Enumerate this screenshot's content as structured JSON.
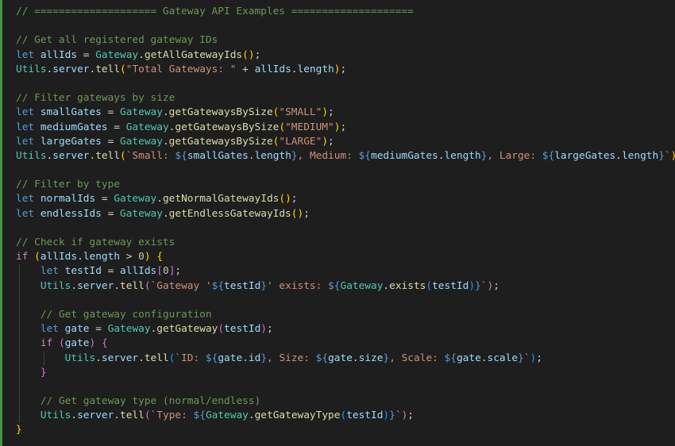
{
  "editor": {
    "lines": [
      [
        [
          "// ==================== Gateway API Examples ====================",
          "comment"
        ]
      ],
      [],
      [
        [
          "// Get all registered gateway IDs",
          "comment"
        ]
      ],
      [
        [
          "let",
          "keyword"
        ],
        [
          " ",
          "punct"
        ],
        [
          "allIds",
          "variable"
        ],
        [
          " = ",
          "punct"
        ],
        [
          "Gateway",
          "class"
        ],
        [
          ".",
          "punct"
        ],
        [
          "getAllGatewayIds",
          "function"
        ],
        [
          "()",
          "bracket1"
        ],
        [
          ";",
          "punct"
        ]
      ],
      [
        [
          "Utils",
          "class"
        ],
        [
          ".",
          "punct"
        ],
        [
          "server",
          "variable"
        ],
        [
          ".",
          "punct"
        ],
        [
          "tell",
          "function"
        ],
        [
          "(",
          "bracket1"
        ],
        [
          "\"Total Gateways: \"",
          "string"
        ],
        [
          " + ",
          "punct"
        ],
        [
          "allIds",
          "variable"
        ],
        [
          ".",
          "punct"
        ],
        [
          "length",
          "variable"
        ],
        [
          ")",
          "bracket1"
        ],
        [
          ";",
          "punct"
        ]
      ],
      [],
      [
        [
          "// Filter gateways by size",
          "comment"
        ]
      ],
      [
        [
          "let",
          "keyword"
        ],
        [
          " ",
          "punct"
        ],
        [
          "smallGates",
          "variable"
        ],
        [
          " = ",
          "punct"
        ],
        [
          "Gateway",
          "class"
        ],
        [
          ".",
          "punct"
        ],
        [
          "getGatewaysBySize",
          "function"
        ],
        [
          "(",
          "bracket1"
        ],
        [
          "\"SMALL\"",
          "string"
        ],
        [
          ")",
          "bracket1"
        ],
        [
          ";",
          "punct"
        ]
      ],
      [
        [
          "let",
          "keyword"
        ],
        [
          " ",
          "punct"
        ],
        [
          "mediumGates",
          "variable"
        ],
        [
          " = ",
          "punct"
        ],
        [
          "Gateway",
          "class"
        ],
        [
          ".",
          "punct"
        ],
        [
          "getGatewaysBySize",
          "function"
        ],
        [
          "(",
          "bracket1"
        ],
        [
          "\"MEDIUM\"",
          "string"
        ],
        [
          ")",
          "bracket1"
        ],
        [
          ";",
          "punct"
        ]
      ],
      [
        [
          "let",
          "keyword"
        ],
        [
          " ",
          "punct"
        ],
        [
          "largeGates",
          "variable"
        ],
        [
          " = ",
          "punct"
        ],
        [
          "Gateway",
          "class"
        ],
        [
          ".",
          "punct"
        ],
        [
          "getGatewaysBySize",
          "function"
        ],
        [
          "(",
          "bracket1"
        ],
        [
          "\"LARGE\"",
          "string"
        ],
        [
          ")",
          "bracket1"
        ],
        [
          ";",
          "punct"
        ]
      ],
      [
        [
          "Utils",
          "class"
        ],
        [
          ".",
          "punct"
        ],
        [
          "server",
          "variable"
        ],
        [
          ".",
          "punct"
        ],
        [
          "tell",
          "function"
        ],
        [
          "(",
          "bracket1"
        ],
        [
          "`Small: ",
          "string"
        ],
        [
          "${",
          "interp"
        ],
        [
          "smallGates",
          "variable"
        ],
        [
          ".",
          "punct"
        ],
        [
          "length",
          "variable"
        ],
        [
          "}",
          "interp"
        ],
        [
          ", Medium: ",
          "string"
        ],
        [
          "${",
          "interp"
        ],
        [
          "mediumGates",
          "variable"
        ],
        [
          ".",
          "punct"
        ],
        [
          "length",
          "variable"
        ],
        [
          "}",
          "interp"
        ],
        [
          ", Large: ",
          "string"
        ],
        [
          "${",
          "interp"
        ],
        [
          "largeGates",
          "variable"
        ],
        [
          ".",
          "punct"
        ],
        [
          "length",
          "variable"
        ],
        [
          "}",
          "interp"
        ],
        [
          "`",
          "string"
        ],
        [
          ")",
          "bracket1"
        ],
        [
          ";",
          "punct"
        ]
      ],
      [],
      [
        [
          "// Filter by type",
          "comment"
        ]
      ],
      [
        [
          "let",
          "keyword"
        ],
        [
          " ",
          "punct"
        ],
        [
          "normalIds",
          "variable"
        ],
        [
          " = ",
          "punct"
        ],
        [
          "Gateway",
          "class"
        ],
        [
          ".",
          "punct"
        ],
        [
          "getNormalGatewayIds",
          "function"
        ],
        [
          "()",
          "bracket1"
        ],
        [
          ";",
          "punct"
        ]
      ],
      [
        [
          "let",
          "keyword"
        ],
        [
          " ",
          "punct"
        ],
        [
          "endlessIds",
          "variable"
        ],
        [
          " = ",
          "punct"
        ],
        [
          "Gateway",
          "class"
        ],
        [
          ".",
          "punct"
        ],
        [
          "getEndlessGatewayIds",
          "function"
        ],
        [
          "()",
          "bracket1"
        ],
        [
          ";",
          "punct"
        ]
      ],
      [],
      [
        [
          "// Check if gateway exists",
          "comment"
        ]
      ],
      [
        [
          "if",
          "control"
        ],
        [
          " ",
          "punct"
        ],
        [
          "(",
          "bracket1"
        ],
        [
          "allIds",
          "variable"
        ],
        [
          ".",
          "punct"
        ],
        [
          "length",
          "variable"
        ],
        [
          " > ",
          "punct"
        ],
        [
          "0",
          "number"
        ],
        [
          ")",
          "bracket1"
        ],
        [
          " ",
          "punct"
        ],
        [
          "{",
          "bracket1"
        ]
      ],
      [
        [
          "    ",
          "punct"
        ],
        [
          "let",
          "keyword"
        ],
        [
          " ",
          "punct"
        ],
        [
          "testId",
          "variable"
        ],
        [
          " = ",
          "punct"
        ],
        [
          "allIds",
          "variable"
        ],
        [
          "[",
          "bracket2"
        ],
        [
          "0",
          "number"
        ],
        [
          "]",
          "bracket2"
        ],
        [
          ";",
          "punct"
        ]
      ],
      [
        [
          "    ",
          "punct"
        ],
        [
          "Utils",
          "class"
        ],
        [
          ".",
          "punct"
        ],
        [
          "server",
          "variable"
        ],
        [
          ".",
          "punct"
        ],
        [
          "tell",
          "function"
        ],
        [
          "(",
          "bracket2"
        ],
        [
          "`Gateway '",
          "string"
        ],
        [
          "${",
          "interp"
        ],
        [
          "testId",
          "variable"
        ],
        [
          "}",
          "interp"
        ],
        [
          "' exists: ",
          "string"
        ],
        [
          "${",
          "interp"
        ],
        [
          "Gateway",
          "class"
        ],
        [
          ".",
          "punct"
        ],
        [
          "exists",
          "function"
        ],
        [
          "(",
          "bracket3"
        ],
        [
          "testId",
          "variable"
        ],
        [
          ")",
          "bracket3"
        ],
        [
          "}",
          "interp"
        ],
        [
          "`",
          "string"
        ],
        [
          ")",
          "bracket2"
        ],
        [
          ";",
          "punct"
        ]
      ],
      [],
      [
        [
          "    ",
          "punct"
        ],
        [
          "// Get gateway configuration",
          "comment"
        ]
      ],
      [
        [
          "    ",
          "punct"
        ],
        [
          "let",
          "keyword"
        ],
        [
          " ",
          "punct"
        ],
        [
          "gate",
          "variable"
        ],
        [
          " = ",
          "punct"
        ],
        [
          "Gateway",
          "class"
        ],
        [
          ".",
          "punct"
        ],
        [
          "getGateway",
          "function"
        ],
        [
          "(",
          "bracket2"
        ],
        [
          "testId",
          "variable"
        ],
        [
          ")",
          "bracket2"
        ],
        [
          ";",
          "punct"
        ]
      ],
      [
        [
          "    ",
          "punct"
        ],
        [
          "if",
          "control"
        ],
        [
          " ",
          "punct"
        ],
        [
          "(",
          "bracket2"
        ],
        [
          "gate",
          "variable"
        ],
        [
          ")",
          "bracket2"
        ],
        [
          " ",
          "punct"
        ],
        [
          "{",
          "bracket2"
        ]
      ],
      [
        [
          "        ",
          "punct"
        ],
        [
          "Utils",
          "class"
        ],
        [
          ".",
          "punct"
        ],
        [
          "server",
          "variable"
        ],
        [
          ".",
          "punct"
        ],
        [
          "tell",
          "function"
        ],
        [
          "(",
          "bracket3"
        ],
        [
          "`ID: ",
          "string"
        ],
        [
          "${",
          "interp"
        ],
        [
          "gate",
          "variable"
        ],
        [
          ".",
          "punct"
        ],
        [
          "id",
          "variable"
        ],
        [
          "}",
          "interp"
        ],
        [
          ", Size: ",
          "string"
        ],
        [
          "${",
          "interp"
        ],
        [
          "gate",
          "variable"
        ],
        [
          ".",
          "punct"
        ],
        [
          "size",
          "variable"
        ],
        [
          "}",
          "interp"
        ],
        [
          ", Scale: ",
          "string"
        ],
        [
          "${",
          "interp"
        ],
        [
          "gate",
          "variable"
        ],
        [
          ".",
          "punct"
        ],
        [
          "scale",
          "variable"
        ],
        [
          "}",
          "interp"
        ],
        [
          "`",
          "string"
        ],
        [
          ")",
          "bracket3"
        ],
        [
          ";",
          "punct"
        ]
      ],
      [
        [
          "    ",
          "punct"
        ],
        [
          "}",
          "bracket2"
        ]
      ],
      [],
      [
        [
          "    ",
          "punct"
        ],
        [
          "// Get gateway type (normal/endless)",
          "comment"
        ]
      ],
      [
        [
          "    ",
          "punct"
        ],
        [
          "Utils",
          "class"
        ],
        [
          ".",
          "punct"
        ],
        [
          "server",
          "variable"
        ],
        [
          ".",
          "punct"
        ],
        [
          "tell",
          "function"
        ],
        [
          "(",
          "bracket2"
        ],
        [
          "`Type: ",
          "string"
        ],
        [
          "${",
          "interp"
        ],
        [
          "Gateway",
          "class"
        ],
        [
          ".",
          "punct"
        ],
        [
          "getGatewayType",
          "function"
        ],
        [
          "(",
          "bracket3"
        ],
        [
          "testId",
          "variable"
        ],
        [
          ")",
          "bracket3"
        ],
        [
          "}",
          "interp"
        ],
        [
          "`",
          "string"
        ],
        [
          ")",
          "bracket2"
        ],
        [
          ";",
          "punct"
        ]
      ],
      [
        [
          "}",
          "bracket1"
        ]
      ]
    ]
  }
}
